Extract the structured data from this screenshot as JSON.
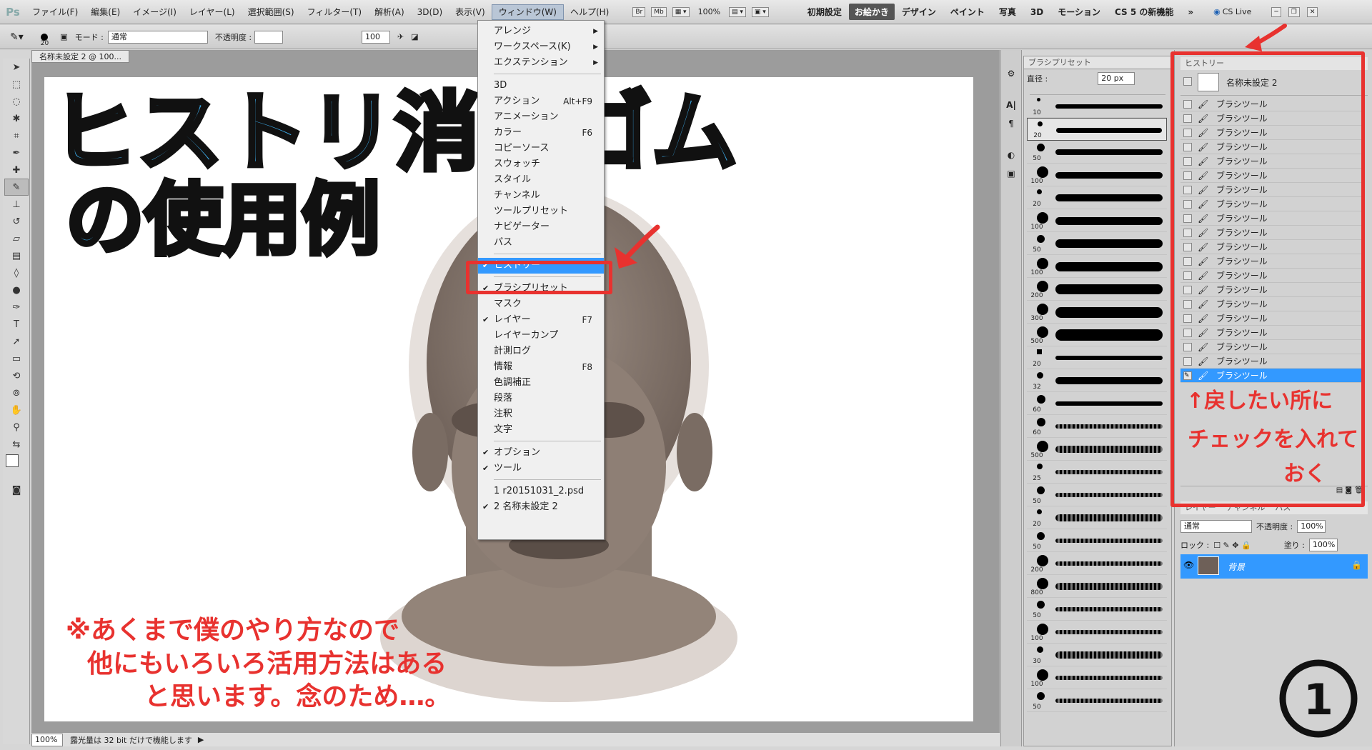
{
  "menubar": {
    "logo": "Ps",
    "items": [
      "ファイル(F)",
      "編集(E)",
      "イメージ(I)",
      "レイヤー(L)",
      "選択範囲(S)",
      "フィルター(T)",
      "解析(A)",
      "3D(D)",
      "表示(V)",
      "ウィンドウ(W)",
      "ヘルプ(H)"
    ],
    "badges": [
      "Br",
      "Mb"
    ],
    "zoom": "100%",
    "workspaces": [
      "初期設定",
      "お絵かき",
      "デザイン",
      "ペイント",
      "写真",
      "3D",
      "モーション",
      "CS 5 の新機能"
    ],
    "cslive": "CS Live"
  },
  "optbar": {
    "brush_size": "20",
    "mode_label": "モード :",
    "mode_value": "通常",
    "opacity_label": "不透明度 :",
    "flow_value": "100"
  },
  "document": {
    "tab": "名称未設定 2 @ 100...",
    "status_zoom": "100%",
    "status_text": "露光量は 32 bit だけで機能します"
  },
  "window_menu": {
    "items": [
      {
        "label": "アレンジ",
        "shortcut": "",
        "arrow": true
      },
      {
        "label": "ワークスペース(K)",
        "shortcut": "",
        "arrow": true
      },
      {
        "label": "エクステンション",
        "shortcut": "",
        "arrow": true
      },
      {
        "label": "3D",
        "shortcut": ""
      },
      {
        "label": "アクション",
        "shortcut": "Alt+F9"
      },
      {
        "label": "アニメーション",
        "shortcut": ""
      },
      {
        "label": "カラー",
        "shortcut": "F6"
      },
      {
        "label": "コピーソース",
        "shortcut": ""
      },
      {
        "label": "スウォッチ",
        "shortcut": ""
      },
      {
        "label": "スタイル",
        "shortcut": ""
      },
      {
        "label": "チャンネル",
        "shortcut": ""
      },
      {
        "label": "ツールプリセット",
        "shortcut": ""
      },
      {
        "label": "ナビゲーター",
        "shortcut": ""
      },
      {
        "label": "パス",
        "shortcut": ""
      },
      {
        "label": "ヒストリー",
        "shortcut": "",
        "checked": true,
        "highlighted": true
      },
      {
        "label": "ブラシプリセット",
        "shortcut": "",
        "checked": true
      },
      {
        "label": "マスク",
        "shortcut": ""
      },
      {
        "label": "レイヤー",
        "shortcut": "F7",
        "checked": true
      },
      {
        "label": "レイヤーカンプ",
        "shortcut": ""
      },
      {
        "label": "計測ログ",
        "shortcut": ""
      },
      {
        "label": "情報",
        "shortcut": "F8"
      },
      {
        "label": "色調補正",
        "shortcut": ""
      },
      {
        "label": "段落",
        "shortcut": ""
      },
      {
        "label": "注釈",
        "shortcut": ""
      },
      {
        "label": "文字",
        "shortcut": ""
      },
      {
        "label": "オプション",
        "shortcut": "",
        "checked": true
      },
      {
        "label": "ツール",
        "shortcut": "",
        "checked": true
      },
      {
        "label": "1 r20151031_2.psd",
        "shortcut": ""
      },
      {
        "label": "2 名称未設定 2",
        "shortcut": "",
        "checked": true
      }
    ]
  },
  "brush_panel": {
    "title": "ブラシプリセット",
    "diameter_label": "直径 :",
    "diameter_value": "20 px",
    "sizes": [
      "10",
      "20",
      "50",
      "100",
      "20",
      "100",
      "50",
      "100",
      "200",
      "300",
      "500",
      "20",
      "32",
      "60",
      "60",
      "500",
      "25",
      "50",
      "20",
      "50",
      "200",
      "800",
      "50",
      "100",
      "30",
      "100",
      "50"
    ]
  },
  "history_panel": {
    "title": "ヒストリー",
    "snapshot": "名称未設定 2",
    "step_label": "ブラシツール",
    "step_count": 20
  },
  "layers_panel": {
    "tabs": [
      "レイヤー",
      "チャンネル",
      "パス"
    ],
    "blend": "通常",
    "opacity_label": "不透明度 :",
    "opacity": "100%",
    "lock_label": "ロック :",
    "fill_label": "塗り :",
    "fill": "100%",
    "layer_name": "背景"
  },
  "annotations": {
    "title_line1": "ヒストリ消しゴム",
    "title_line2": "の使用例",
    "note_line1": "※あくまで僕のやり方なので",
    "note_line2": "他にもいろいろ活用方法はある",
    "note_line3": "と思います。念のため…。",
    "history_note_line1": "↑戻したい所に",
    "history_note_line2": "チェックを入れて",
    "history_note_line3": "おく",
    "page_number": "1"
  },
  "colors": {
    "accent": "#3399ff",
    "annotation_red": "#e8322f",
    "title_blue": "#3aa8e6",
    "skin": "#8a7b70"
  }
}
